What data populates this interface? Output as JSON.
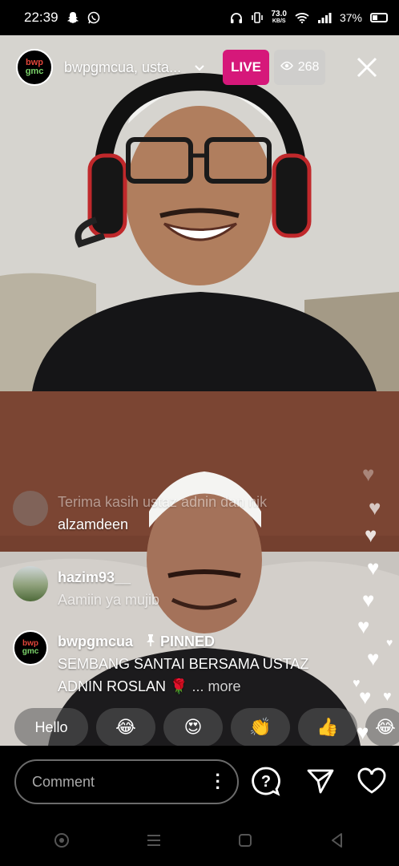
{
  "status_bar": {
    "time": "22:39",
    "net_speed": "73.0",
    "net_unit": "KB/S",
    "battery": "37%",
    "icons": [
      "snapchat-icon",
      "whatsapp-icon",
      "headphones-icon",
      "vibrate-icon",
      "wifi-icon",
      "signal-icon",
      "battery-icon"
    ]
  },
  "header": {
    "host_avatar_top": "bwp",
    "host_avatar_bottom": "gmc",
    "host_name": "bwpgmcua, usta...",
    "live_label": "LIVE",
    "viewer_count": "268"
  },
  "comments": [
    {
      "user": "",
      "text": "Terima kasih ustaz adnin dan nik",
      "faded": true
    },
    {
      "user": "alzamdeen",
      "text": "",
      "faded": false
    },
    {
      "user": "hazim93__",
      "text": "Aamiin ya mujib",
      "faded": false
    },
    {
      "user": "bwpgmcua",
      "pinned_label": "PINNED",
      "text_line1": "SEMBANG SANTAI BERSAMA USTAZ",
      "text_line2": "ADNIN ROSLAN 🌹",
      "more": "... more"
    }
  ],
  "quick_reactions": [
    "Hello",
    "😂",
    "😍",
    "👏",
    "👍",
    "😂"
  ],
  "bottom_bar": {
    "comment_placeholder": "Comment"
  },
  "colors": {
    "live": "#d6187a",
    "background": "#000000"
  }
}
